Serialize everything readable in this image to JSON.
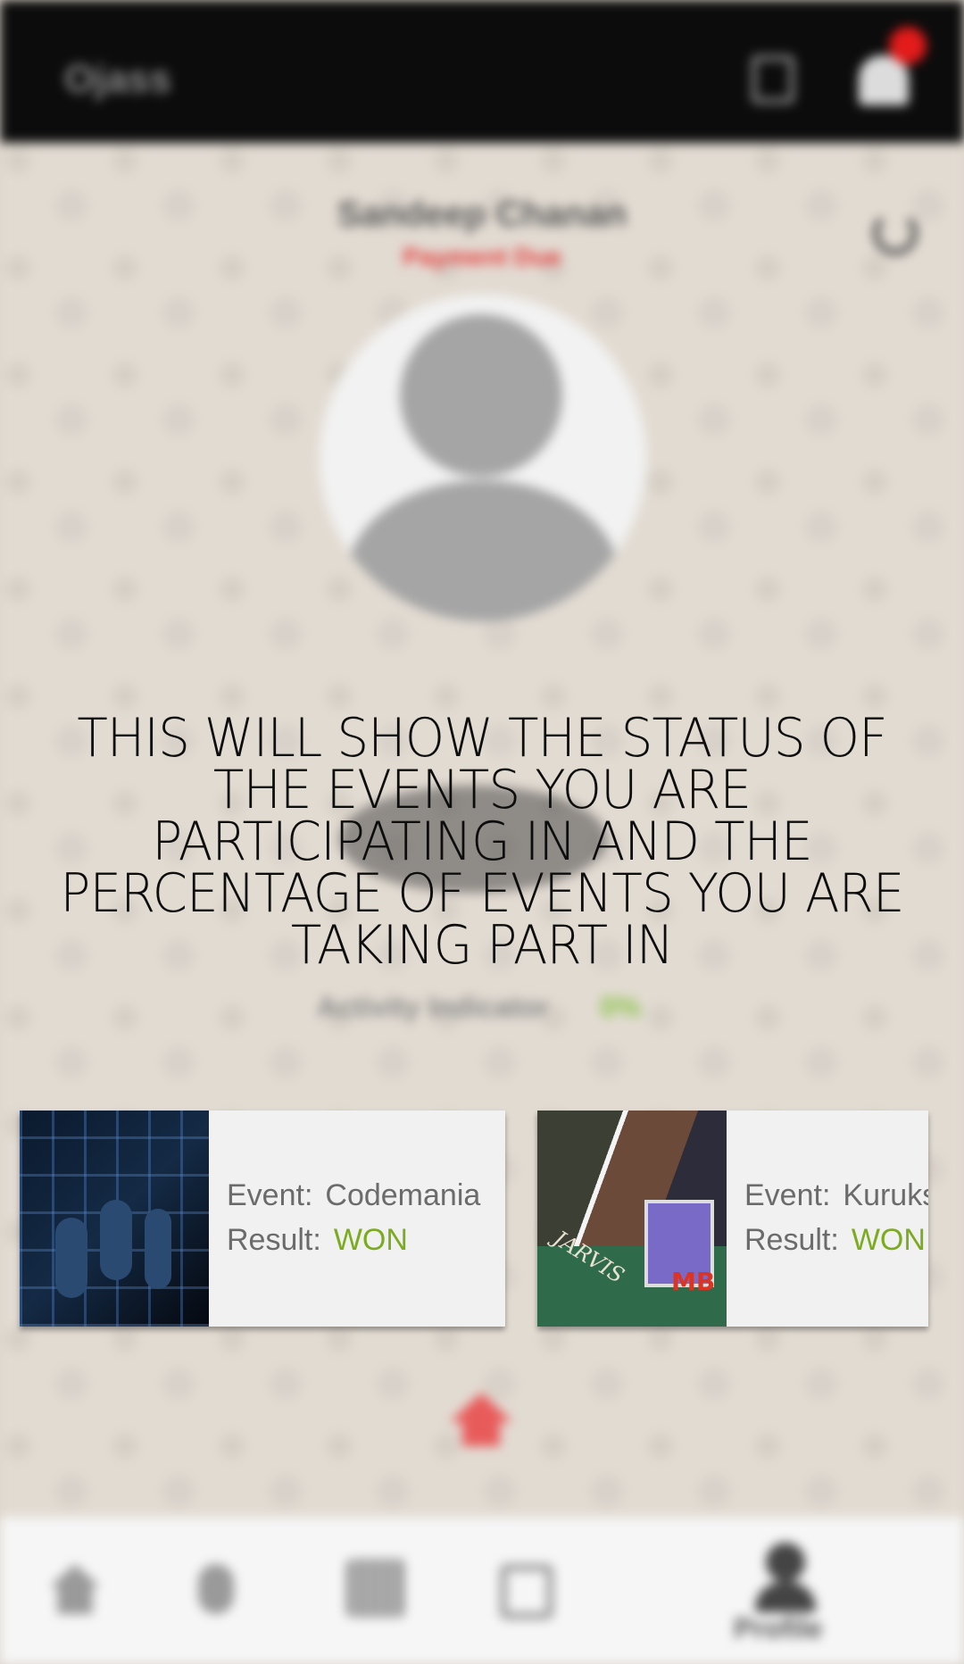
{
  "header": {
    "brand": "Ojass"
  },
  "profile": {
    "name": "Sandeep Chanan",
    "payment_status": "Payment Due",
    "activity_label": "Activity Indicator",
    "activity_value": "0%"
  },
  "tutorial": {
    "text": "THIS WILL SHOW THE STATUS OF THE EVENTS YOU ARE PARTICIPATING IN AND THE PERCENTAGE OF EVENTS YOU ARE TAKING PART IN"
  },
  "events": [
    {
      "event_label": "Event:",
      "event_name": "Codemania",
      "result_label": "Result:",
      "result": "WON"
    },
    {
      "event_label": "Event:",
      "event_name": "Kurukshetra",
      "result_label": "Result:",
      "result": "WON"
    }
  ],
  "thumb_text": {
    "robot_label": "JARVIS",
    "robot_mark": "MB"
  },
  "nav": {
    "profile_label": "Profile"
  },
  "colors": {
    "accent_red": "#e31b1b",
    "won_green": "#7bab1f",
    "activity_green": "#8bc34a"
  },
  "icons": [
    "bookmark-icon",
    "bell-icon",
    "refresh-icon",
    "home-icon",
    "dance-icon",
    "qr-code-icon",
    "calendar-icon",
    "profile-icon",
    "scroll-top-icon"
  ]
}
